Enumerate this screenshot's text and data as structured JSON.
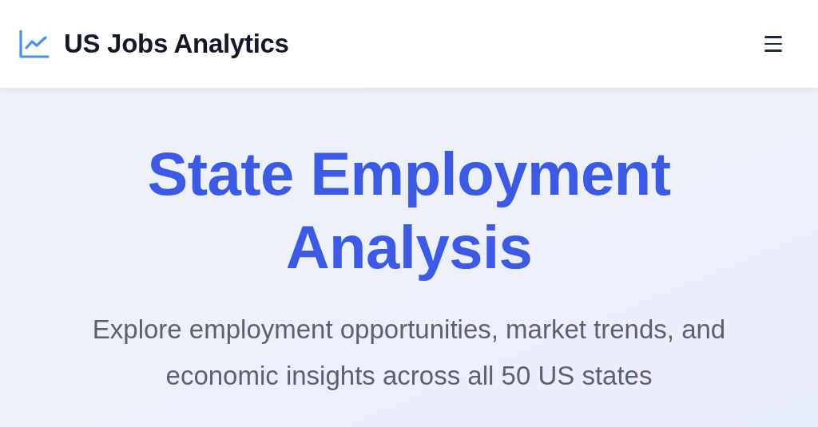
{
  "header": {
    "title": "US Jobs Analytics"
  },
  "hero": {
    "heading": "State Employment Analysis",
    "subtitle": "Explore employment opportunities, market trends, and economic insights across all 50 US states"
  }
}
